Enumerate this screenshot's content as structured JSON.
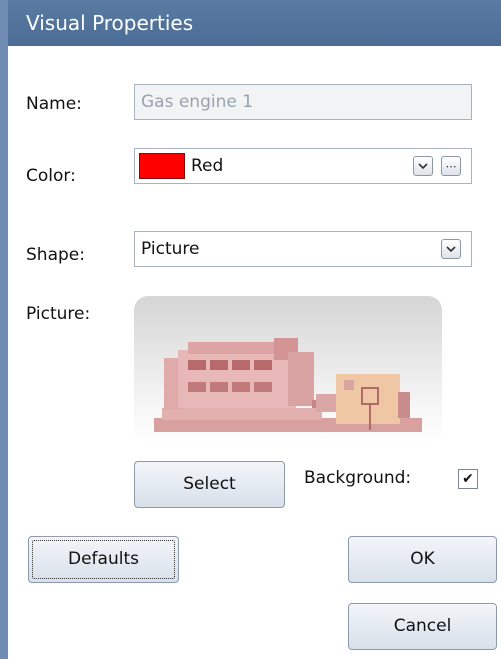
{
  "window": {
    "title": "Visual Properties"
  },
  "name": {
    "label": "Name:",
    "value": "Gas engine 1"
  },
  "color": {
    "label": "Color:",
    "value": "Red",
    "swatch": "#ff0000",
    "dropdown_icon": "chevron-down-icon",
    "more_label": "⋯"
  },
  "shape": {
    "label": "Shape:",
    "value": "Picture",
    "dropdown_icon": "chevron-down-icon"
  },
  "picture": {
    "label": "Picture:",
    "image": "gas-engine-generator"
  },
  "select_button": {
    "label": "Select"
  },
  "background": {
    "label": "Background:",
    "checked": true,
    "check_mark": "✔"
  },
  "buttons": {
    "defaults": "Defaults",
    "ok": "OK",
    "cancel": "Cancel"
  },
  "colors": {
    "title_bar": "#4f7098",
    "engine": "#d99a9a",
    "engine_dark": "#b25a5a",
    "red": "#ff0000"
  }
}
